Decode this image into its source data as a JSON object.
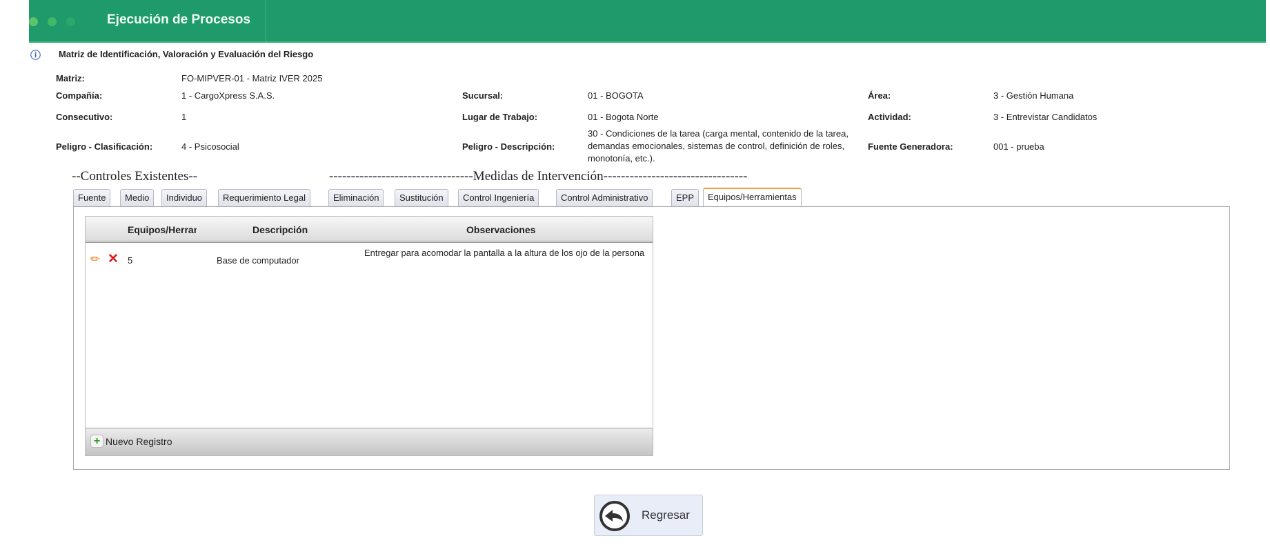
{
  "header": {
    "title": "Ejecución de Procesos"
  },
  "page": {
    "subtitle": "Matriz de Identificación, Valoración y Evaluación del Riesgo"
  },
  "fields": {
    "matriz": {
      "label": "Matriz:",
      "value": "FO-MIPVER-01 - Matriz IVER 2025"
    },
    "compania": {
      "label": "Compañía:",
      "value": "1 - CargoXpress S.A.S."
    },
    "consecutivo": {
      "label": "Consecutivo:",
      "value": "1"
    },
    "peligro_clasificacion": {
      "label": "Peligro - Clasificación:",
      "value": "4 - Psicosocial"
    },
    "sucursal": {
      "label": "Sucursal:",
      "value": "01 - BOGOTA"
    },
    "lugar": {
      "label": "Lugar de Trabajo:",
      "value": "01 - Bogota Norte"
    },
    "peligro_descripcion": {
      "label": "Peligro - Descripción:",
      "value": "30 - Condiciones de la tarea (carga mental, contenido de la tarea, demandas emocionales, sistemas de control, definición de roles, monotonía, etc.)."
    },
    "area": {
      "label": "Área:",
      "value": "3 - Gestión Humana"
    },
    "actividad": {
      "label": "Actividad:",
      "value": "3 - Entrevistar Candidatos"
    },
    "fuente": {
      "label": "Fuente Generadora:",
      "value": "001 - prueba"
    }
  },
  "sections": {
    "controles": "--Controles Existentes--",
    "medidas": "---------------------------------Medidas de Intervención---------------------------------"
  },
  "tabs": [
    "Fuente",
    "Medio",
    "Individuo",
    "Requerimiento Legal",
    "Eliminación",
    "Sustitución",
    "Control Ingeniería",
    "Control Administrativo",
    "EPP",
    "Equipos/Herramientas"
  ],
  "active_tab": "Equipos/Herramientas",
  "grid": {
    "columns": [
      "Equipos/Herran",
      "Descripción",
      "Observaciones"
    ],
    "rows": [
      {
        "equipo": "5",
        "descripcion": "Base de computador",
        "observaciones": "Entregar para acomodar la pantalla a la altura de los ojo de la persona"
      }
    ],
    "new_label": "Nuevo Registro"
  },
  "back_button": "Regresar"
}
